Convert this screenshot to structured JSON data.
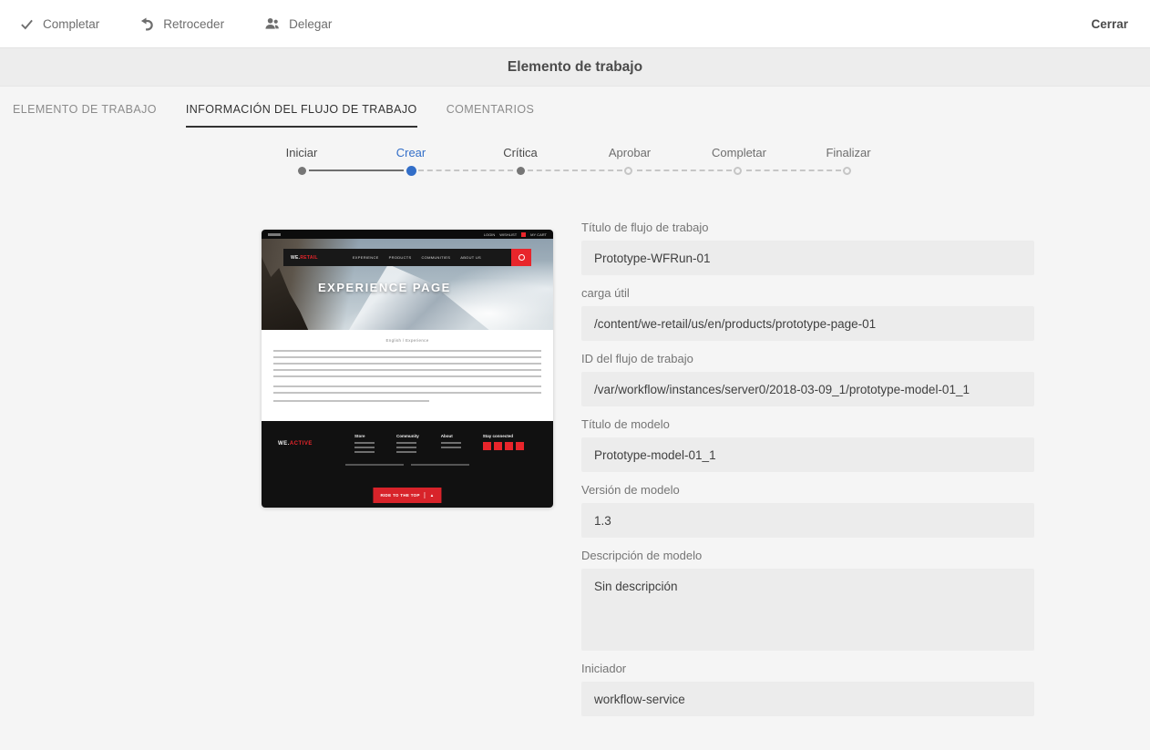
{
  "colors": {
    "accent_blue": "#326ec8",
    "brand_red": "#e8252b",
    "text_dark": "#4b4b4b",
    "text_gray": "#757575",
    "field_bg": "#ececec"
  },
  "toolbar": {
    "complete_label": "Completar",
    "back_label": "Retroceder",
    "delegate_label": "Delegar",
    "close_label": "Cerrar"
  },
  "header": {
    "title": "Elemento de trabajo"
  },
  "tabs": [
    {
      "label": "ELEMENTO DE TRABAJO",
      "active": false
    },
    {
      "label": "INFORMACIÓN DEL FLUJO DE TRABAJO",
      "active": true
    },
    {
      "label": "COMENTARIOS",
      "active": false
    }
  ],
  "steps": [
    {
      "label": "Iniciar",
      "state": "done"
    },
    {
      "label": "Crear",
      "state": "current"
    },
    {
      "label": "Crítica",
      "state": "done"
    },
    {
      "label": "Aprobar",
      "state": "pending"
    },
    {
      "label": "Completar",
      "state": "pending"
    },
    {
      "label": "Finalizar",
      "state": "pending"
    }
  ],
  "form": {
    "fields": [
      {
        "label": "Título de flujo de trabajo",
        "value": "Prototype-WFRun-01"
      },
      {
        "label": "carga útil",
        "value": "/content/we-retail/us/en/products/prototype-page-01"
      },
      {
        "label": "ID del flujo de trabajo",
        "value": "/var/workflow/instances/server0/2018-03-09_1/prototype-model-01_1"
      },
      {
        "label": "Título de modelo",
        "value": "Prototype-model-01_1"
      },
      {
        "label": "Versión de modelo",
        "value": "1.3"
      },
      {
        "label": "Descripción de modelo",
        "value": "Sin descripción",
        "multiline": true
      },
      {
        "label": "Iniciador",
        "value": "workflow-service"
      }
    ]
  },
  "thumbnail": {
    "topbar_right": [
      "LOGIN",
      "WISHLIST",
      "MY CART"
    ],
    "logo_prefix": "WE.",
    "logo_suffix": "RETAIL",
    "menu": [
      "EXPERIENCE",
      "PRODUCTS",
      "COMMUNITIES",
      "ABOUT US"
    ],
    "hero_title": "EXPERIENCE PAGE",
    "breadcrumb": "English  /  Experience",
    "footer_logo_prefix": "WE.",
    "footer_logo_suffix": "ACTIVE",
    "footer_columns": [
      "Store",
      "Community",
      "About"
    ],
    "stay_connected": "Stay connected",
    "back_to_top": "RIDE TO THE TOP"
  }
}
